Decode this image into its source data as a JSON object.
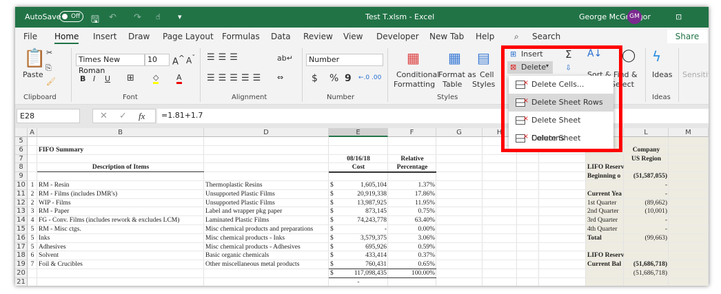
{
  "titlebar": {
    "autosave": "AutoSave",
    "autosave_state": "Off",
    "title": "Test T.xlsm  -  Excel",
    "user": "George McGreggor",
    "initials": "GM",
    "color": "#217346"
  },
  "tabs": [
    "File",
    "Home",
    "Insert",
    "Draw",
    "Page Layout",
    "Formulas",
    "Data",
    "Review",
    "View",
    "Developer",
    "New Tab",
    "Help"
  ],
  "search": "Search",
  "share": "Share",
  "ribbon": {
    "paste": "Paste",
    "clipboard": "Clipboard",
    "font_name": "Times New Roman",
    "font_size": "10",
    "bold": "B",
    "italic": "I",
    "underline": "U",
    "font": "Font",
    "alignment": "Alignment",
    "number_format": "Number",
    "currency": "$",
    "percent": "%",
    "comma": "9",
    "number": "Number",
    "conditional": "Conditional",
    "formatting": "Formatting",
    "format_as": "Format as",
    "table": "Table",
    "cell": "Cell",
    "styles_btn": "Styles",
    "styles": "Styles",
    "insert": "Insert",
    "delete": "Delete",
    "sort": "Sort &",
    "find": "Find &",
    "select": "Select",
    "ideas_btn": "Ideas",
    "ideas": "Ideas",
    "sensitivity": "Sensitivity"
  },
  "formula_bar": {
    "name_box": "E28",
    "fx": "fx",
    "formula": "=1.81+1.7"
  },
  "delete_menu": [
    "Delete Cells...",
    "Delete Sheet Rows",
    "Delete Sheet Columns",
    "Delete Sheet"
  ],
  "delete_menu_highlighted": "Delete Sheet Rows",
  "columns": [
    "A",
    "B",
    "D",
    "E",
    "F",
    "G",
    "H",
    "L",
    "M"
  ],
  "rows": [
    {
      "n": "5"
    },
    {
      "n": "6",
      "B": "FIFO Summary",
      "L": "Company"
    },
    {
      "n": "7",
      "E": "08/16/18",
      "F": "Relative",
      "L": "US Region"
    },
    {
      "n": "8",
      "B": "Description of Items",
      "E": "Cost",
      "F": "Percentage",
      "K": "LIFO Reserve -"
    },
    {
      "n": "9",
      "K": "Beginning o",
      "L": "(51,587,055)"
    },
    {
      "n": "10",
      "A": "1",
      "B": "RM - Resin",
      "D": "Thermoplastic Resins",
      "S": "$",
      "E": "1,605,104",
      "F": "1.37%",
      "L": "-"
    },
    {
      "n": "11",
      "A": "2",
      "B": "RM - Films (includes DMR's)",
      "D": "Unsupported Plastic Films",
      "S": "$",
      "E": "20,919,338",
      "F": "17.86%",
      "K": "Current Yea",
      "L": "-"
    },
    {
      "n": "12",
      "A": "2",
      "B": "WIP - Films",
      "D": "Unsupported Plastic Films",
      "S": "$",
      "E": "13,987,925",
      "F": "11.95%",
      "K": " 1st Quarter",
      "L": "(89,662)"
    },
    {
      "n": "13",
      "A": "3",
      "B": "RM - Paper",
      "D": "Label and wrapper pkg paper",
      "S": "$",
      "E": "873,145",
      "F": "0.75%",
      "K": " 2nd Quarter",
      "L": "(10,001)"
    },
    {
      "n": "14",
      "A": "4",
      "B": "FG - Conv. Films (includes rework & excludes LCM)",
      "D": "Laminated Plastic Films",
      "S": "$",
      "E": "74,243,778",
      "F": "63.40%",
      "K": " 3rd Quarter",
      "L": "-"
    },
    {
      "n": "15",
      "A": "5",
      "B": "RM - Misc ctgs.",
      "D": "Misc chemical products and preparations",
      "S": "$",
      "E": "-",
      "F": "0.00%",
      "K": " 4th Quarter",
      "L": "-"
    },
    {
      "n": "16",
      "A": "5",
      "B": "Inks",
      "D": "Misc chemical products - Inks",
      "S": "$",
      "E": "3,579,375",
      "F": "3.06%",
      "K": "Total",
      "L": "(99,663)"
    },
    {
      "n": "17",
      "A": "5",
      "B": "Adhesives",
      "D": "Misc chemical products - Adhesives",
      "S": "$",
      "E": "695,926",
      "F": "0.59%"
    },
    {
      "n": "18",
      "A": "6",
      "B": "Solvent",
      "D": "Basic organic chemicals",
      "S": "$",
      "E": "433,414",
      "F": "0.37%",
      "K": "LIFO Reserve -"
    },
    {
      "n": "19",
      "A": "7",
      "B": "Foil & Crucibles",
      "D": "Other miscellaneous metal products",
      "S": "$",
      "E": "760,431",
      "F": "0.65%",
      "K": "Current Bal",
      "L": "(51,686,718)"
    },
    {
      "n": "20",
      "S": "$",
      "E": "117,098,435",
      "F": "100.00%",
      "L": "(51,686,718)"
    },
    {
      "n": "21",
      "E": "-"
    }
  ],
  "colors": {
    "highlight_box": "#ff0000",
    "beige": "#eeece1"
  }
}
